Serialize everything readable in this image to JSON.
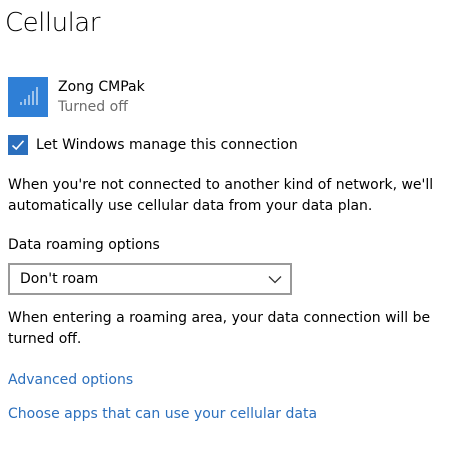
{
  "page": {
    "title": "Cellular"
  },
  "network": {
    "icon": "cellular-signal-icon",
    "name": "Zong CMPak",
    "status": "Turned off",
    "tile_color": "#2f7fd6"
  },
  "manage_checkbox": {
    "label": "Let Windows manage this connection",
    "checked": true,
    "accent_color": "#2b6fbd"
  },
  "description": "When you're not connected to another kind of network, we'll automatically use cellular data from your data plan.",
  "roaming": {
    "label": "Data roaming options",
    "selected": "Don't roam",
    "note": "When entering a roaming area, your data connection will be turned off."
  },
  "links": {
    "advanced": "Advanced options",
    "apps": "Choose apps that can use your cellular data",
    "color": "#2b6fbd"
  }
}
